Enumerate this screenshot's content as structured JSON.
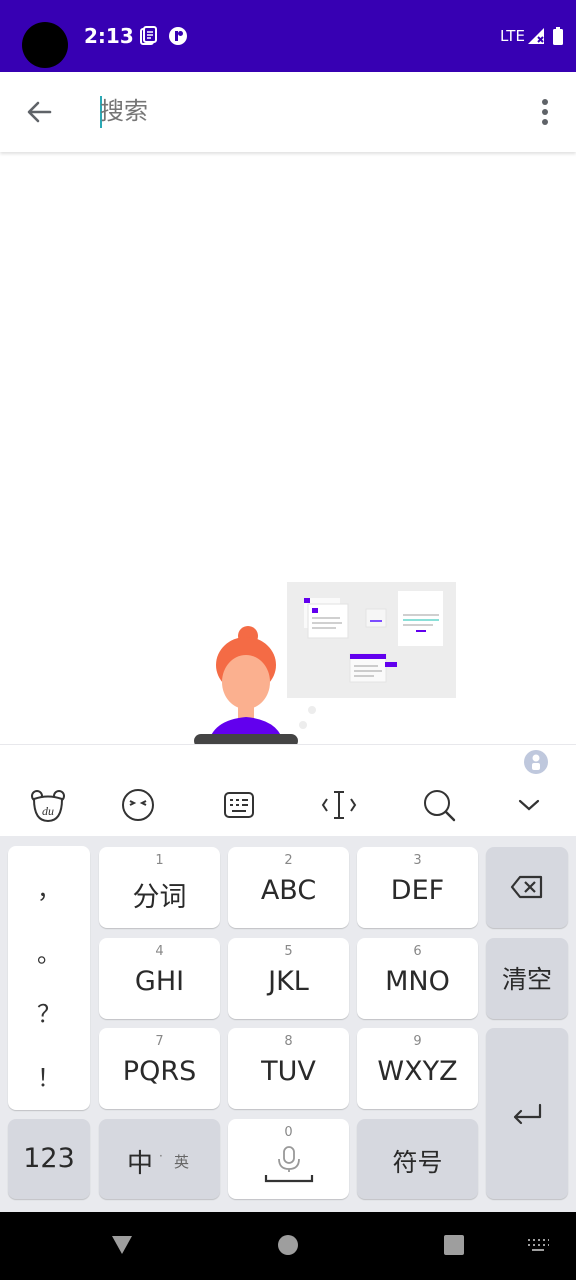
{
  "status_bar": {
    "time": "2:13",
    "network": "LTE",
    "icons": [
      "notes-icon",
      "app-icon",
      "signal-icon",
      "battery-icon"
    ],
    "background": "#3700b3"
  },
  "app_bar": {
    "search_placeholder": "搜索",
    "back_icon": "arrow-back-icon",
    "menu_icon": "more-vert-icon"
  },
  "keyboard": {
    "toolbar_icons": [
      "bear-logo-icon",
      "emoji-icon",
      "keyboard-layout-icon",
      "cursor-icon",
      "search-icon",
      "collapse-icon"
    ],
    "punctuation": [
      "，",
      "。",
      "？",
      "！"
    ],
    "keys": {
      "k1": {
        "num": "1",
        "label": "分词"
      },
      "k2": {
        "num": "2",
        "label": "ABC"
      },
      "k3": {
        "num": "3",
        "label": "DEF"
      },
      "k4": {
        "num": "4",
        "label": "GHI"
      },
      "k5": {
        "num": "5",
        "label": "JKL"
      },
      "k6": {
        "num": "6",
        "label": "MNO"
      },
      "k7": {
        "num": "7",
        "label": "PQRS"
      },
      "k8": {
        "num": "8",
        "label": "TUV"
      },
      "k9": {
        "num": "9",
        "label": "WXYZ"
      },
      "k0": {
        "num": "0"
      }
    },
    "clear_label": "清空",
    "numbers_label": "123",
    "lang_main": "中",
    "lang_alt": "英",
    "symbols_label": "符号"
  }
}
